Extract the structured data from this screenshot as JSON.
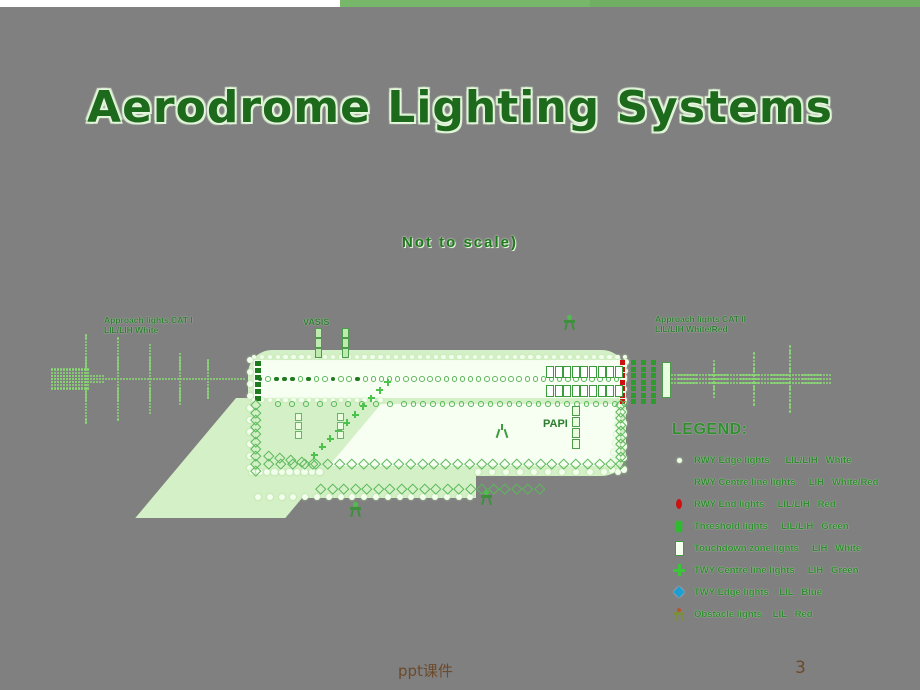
{
  "slide": {
    "title": "Aerodrome Lighting Systems",
    "subtitle": "Not  to  scale)",
    "page_number": "3",
    "footer_note": "ppt课件",
    "background_color": "#808080",
    "accent_green": "#2e8b2e",
    "title_color": "#1d6a1d"
  },
  "diagram": {
    "labels": {
      "approach_left": "Approach lights CAT I\nLIL/LIH  White",
      "vasis": "VASIS",
      "approach_right": "Approach lights CAT II\nLIL/LIH  White/Red",
      "papi": "PAPI"
    }
  },
  "legend": {
    "title": "LEGEND:",
    "items": [
      {
        "icon": "small-white-dot-icon",
        "color": "#e9ffe0",
        "text": "RWY Edge lights      LIL/LIH   White"
      },
      {
        "icon": "no-icon",
        "color": "#00000000",
        "text": "RWY Centre line lights     LIH   White/Red"
      },
      {
        "icon": "red-oval-icon",
        "color": "#cc1111",
        "text": "RWY End lights     LIL/LIH   Red"
      },
      {
        "icon": "green-lamp-icon",
        "color": "#2fbb2f",
        "text": "Threshold lights     LIL/LIH   Green"
      },
      {
        "icon": "white-rect-icon",
        "color": "#f4fff0",
        "text": "Touchdown zone lights     LIH   White"
      },
      {
        "icon": "green-cross-icon",
        "color": "#3cc43c",
        "text": "TWY Centre line lights     LIH   Green"
      },
      {
        "icon": "blue-diamond-icon",
        "color": "#1a9ed4",
        "text": "TWY Edge lights    LIL   Blue"
      },
      {
        "icon": "obstacle-tower-icon",
        "color": "#b5562b",
        "text": "Obstacle lights    LIL   Red"
      }
    ]
  }
}
